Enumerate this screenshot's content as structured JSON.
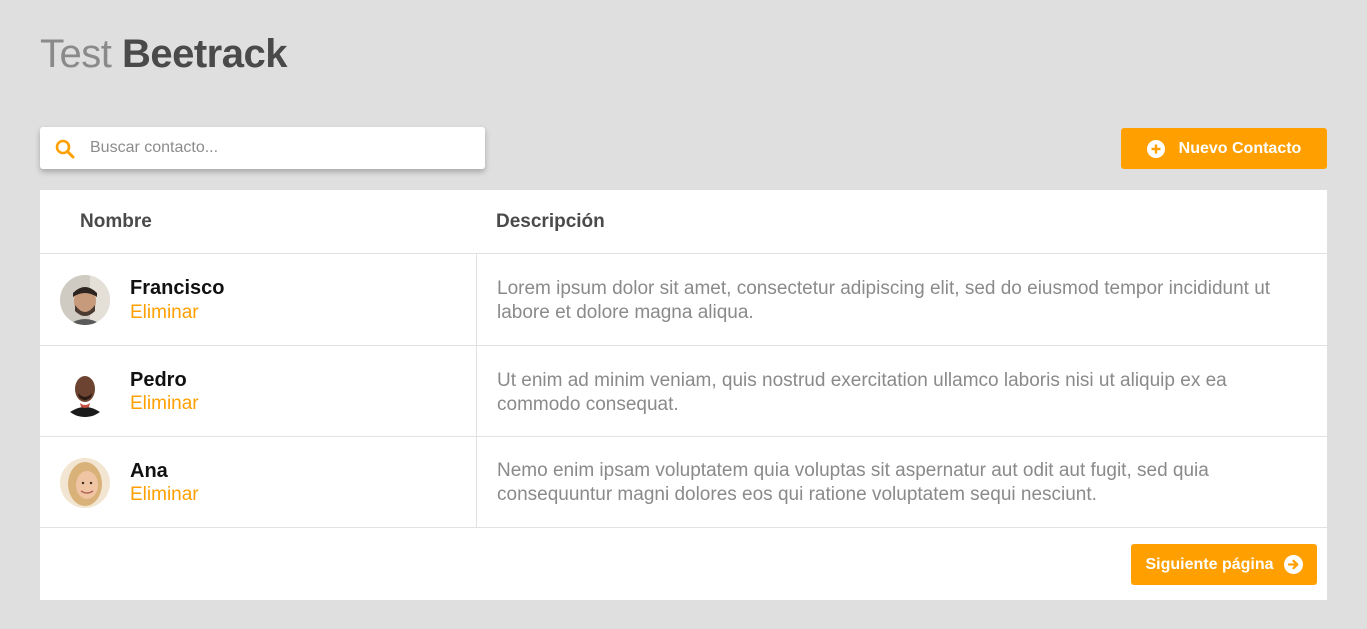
{
  "header": {
    "title_light": "Test",
    "title_bold": "Beetrack"
  },
  "search": {
    "placeholder": "Buscar contacto...",
    "icon": "search-icon"
  },
  "toolbar": {
    "new_contact_label": "Nuevo Contacto",
    "new_contact_icon": "plus-circle-icon"
  },
  "table": {
    "columns": [
      "Nombre",
      "Descripción"
    ],
    "rows": [
      {
        "name": "Francisco",
        "delete_label": "Eliminar",
        "description": "Lorem ipsum dolor sit amet, consectetur adipiscing elit, sed do eiusmod tempor incididunt ut labore et dolore magna aliqua."
      },
      {
        "name": "Pedro",
        "delete_label": "Eliminar",
        "description": "Ut enim ad minim veniam, quis nostrud exercitation ullamco laboris nisi ut aliquip ex ea commodo consequat."
      },
      {
        "name": "Ana",
        "delete_label": "Eliminar",
        "description": "Nemo enim ipsam voluptatem quia voluptas sit aspernatur aut odit aut fugit, sed quia consequuntur magni dolores eos qui ratione voluptatem sequi nesciunt."
      }
    ]
  },
  "pagination": {
    "next_label": "Siguiente página",
    "next_icon": "arrow-right-circle-icon"
  },
  "colors": {
    "accent": "#ffa000",
    "background": "#dfdfdf",
    "panel": "#ffffff",
    "muted_text": "#8a8a8a"
  }
}
